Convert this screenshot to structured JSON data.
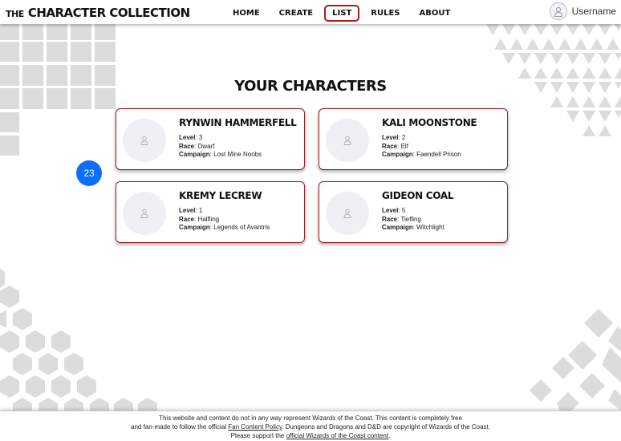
{
  "header": {
    "brand_small": "The",
    "brand_big": "Character Collection",
    "nav": [
      "Home",
      "Create",
      "List",
      "Rules",
      "About"
    ],
    "active_nav": "List",
    "username": "Username"
  },
  "main": {
    "title": "Your Characters",
    "badge": "23",
    "labels": {
      "level": "Level",
      "race": "Race",
      "campaign": "Campaign"
    },
    "characters": [
      {
        "name": "Rynwin Hammerfell",
        "level": "3",
        "race": "Dwarf",
        "campaign": "Lost Mine Noobs"
      },
      {
        "name": "Kali Moonstone",
        "level": "2",
        "race": "Elf",
        "campaign": "Faendell Prison"
      },
      {
        "name": "Kremy Lecrew",
        "level": "1",
        "race": "Halfling",
        "campaign": "Legends of Avantris"
      },
      {
        "name": "Gideon Coal",
        "level": "5",
        "race": "Tiefling",
        "campaign": "Witchlight"
      }
    ]
  },
  "footer": {
    "line1": "This website and content do not in any way represent Wizards of the Coast. This content is completely free",
    "line2_pre": "and fan-made to follow the official ",
    "line2_link": "Fan Content Policy",
    "line2_post": ". Dungeons and Dragons and D&D are copyright of Wizards of the Coast.",
    "line3_pre": "Please support the ",
    "line3_link": "official Wizards of the Coast content",
    "line3_post": "."
  },
  "colors": {
    "accent": "#a81d1d",
    "badge": "#0d6efd",
    "deco": "#d9d9d9"
  },
  "icons": {
    "avatar": "user-icon"
  }
}
